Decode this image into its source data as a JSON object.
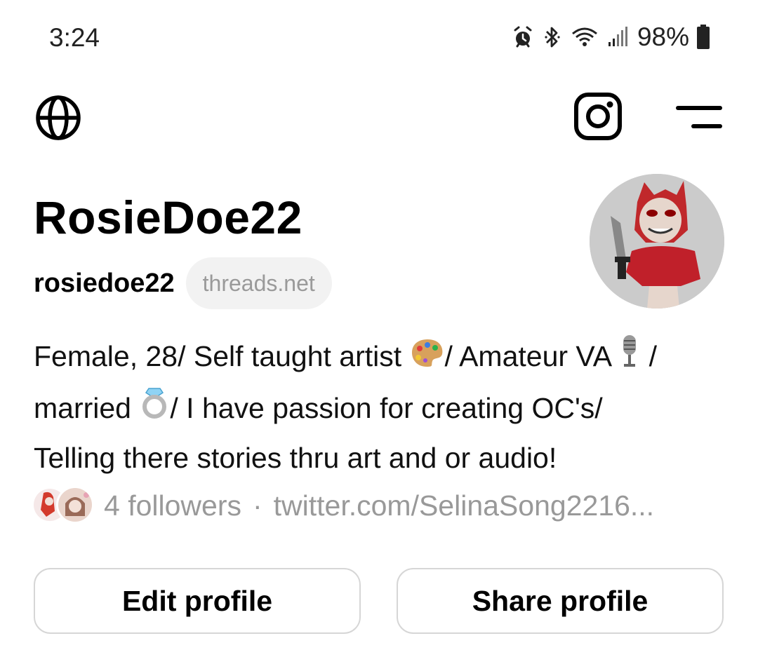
{
  "status_bar": {
    "time": "3:24",
    "battery_percent": "98%",
    "icons": [
      "alarm-icon",
      "bluetooth-icon",
      "wifi-icon",
      "signal-icon",
      "battery-icon"
    ]
  },
  "topbar": {
    "icons": [
      "globe-icon",
      "instagram-icon",
      "menu-icon"
    ]
  },
  "profile": {
    "display_name": "RosieDoe22",
    "username": "rosiedoe22",
    "domain_badge": "threads.net",
    "bio": {
      "part1": "Female, 28/ Self taught artist ",
      "part2": "/ Amateur VA ",
      "part3": " /",
      "part4": "married ",
      "part5": "/ I have passion for creating OC's/",
      "part6": "Telling there stories thru art and or audio!"
    },
    "followers": "4 followers",
    "separator": "·",
    "link": "twitter.com/SelinaSong2216..."
  },
  "buttons": {
    "edit": "Edit profile",
    "share": "Share profile"
  },
  "colors": {
    "background": "#ffffff",
    "muted_text": "#999999",
    "badge_bg": "#f2f2f2",
    "button_border": "#d6d6d6"
  }
}
